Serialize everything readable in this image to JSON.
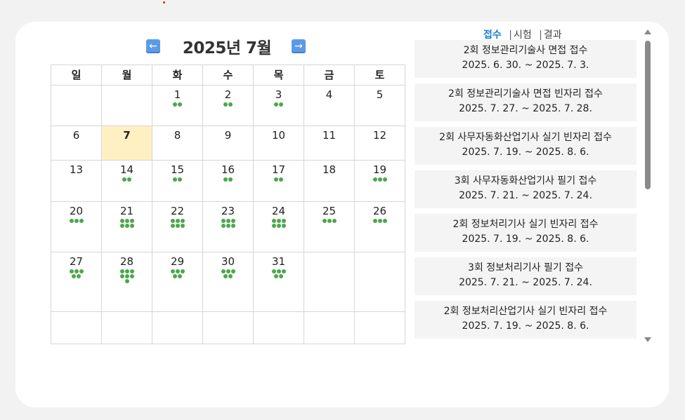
{
  "calendar": {
    "title": "2025년 7월",
    "prev_icon": "left-arrow-icon",
    "next_icon": "right-arrow-icon",
    "weekdays": [
      "일",
      "월",
      "화",
      "수",
      "목",
      "금",
      "토"
    ],
    "today": 7,
    "weeks": [
      [
        null,
        null,
        {
          "d": "1",
          "dots": 2
        },
        {
          "d": "2",
          "dots": 2
        },
        {
          "d": "3",
          "dots": 2
        },
        {
          "d": "4",
          "dots": 0
        },
        {
          "d": "5",
          "dots": 0
        }
      ],
      [
        {
          "d": "6",
          "dots": 0
        },
        {
          "d": "7",
          "dots": 0,
          "today": true
        },
        {
          "d": "8",
          "dots": 0
        },
        {
          "d": "9",
          "dots": 0
        },
        {
          "d": "10",
          "dots": 0
        },
        {
          "d": "11",
          "dots": 0
        },
        {
          "d": "12",
          "dots": 0
        }
      ],
      [
        {
          "d": "13",
          "dots": 0
        },
        {
          "d": "14",
          "dots": 2
        },
        {
          "d": "15",
          "dots": 2
        },
        {
          "d": "16",
          "dots": 2
        },
        {
          "d": "17",
          "dots": 2
        },
        {
          "d": "18",
          "dots": 0
        },
        {
          "d": "19",
          "dots": 3
        }
      ],
      [
        {
          "d": "20",
          "dots": 3
        },
        {
          "d": "21",
          "dots": 6
        },
        {
          "d": "22",
          "dots": 6
        },
        {
          "d": "23",
          "dots": 6
        },
        {
          "d": "24",
          "dots": 6
        },
        {
          "d": "25",
          "dots": 3
        },
        {
          "d": "26",
          "dots": 3
        }
      ],
      [
        {
          "d": "27",
          "dots": 5
        },
        {
          "d": "28",
          "dots": 7
        },
        {
          "d": "29",
          "dots": 5
        },
        {
          "d": "30",
          "dots": 5
        },
        {
          "d": "31",
          "dots": 5
        },
        null,
        null
      ],
      [
        null,
        null,
        null,
        null,
        null,
        null,
        null
      ]
    ],
    "dot_color": "#4aa84a",
    "today_bg": "#fff0c4"
  },
  "tabs": [
    {
      "label": "접수",
      "active": true
    },
    {
      "label": "시험",
      "active": false
    },
    {
      "label": "결과",
      "active": false
    }
  ],
  "events": [
    {
      "title": "2회 정보관리기술사 면접 접수",
      "period": "2025. 6. 30. ~ 2025. 7. 3."
    },
    {
      "title": "2회 정보관리기술사 면접 빈자리 접수",
      "period": "2025. 7. 27. ~ 2025. 7. 28."
    },
    {
      "title": "2회 사무자동화산업기사 실기 빈자리 접수",
      "period": "2025. 7. 19. ~ 2025. 8. 6."
    },
    {
      "title": "3회 사무자동화산업기사 필기 접수",
      "period": "2025. 7. 21. ~ 2025. 7. 24."
    },
    {
      "title": "2회 정보처리기사 실기 빈자리 접수",
      "period": "2025. 7. 19. ~ 2025. 8. 6."
    },
    {
      "title": "3회 정보처리기사 필기 접수",
      "period": "2025. 7. 21. ~ 2025. 7. 24."
    },
    {
      "title": "2회 정보처리산업기사 실기 빈자리 접수",
      "period": "2025. 7. 19. ~ 2025. 8. 6."
    }
  ],
  "accent": "#1a7fd6"
}
